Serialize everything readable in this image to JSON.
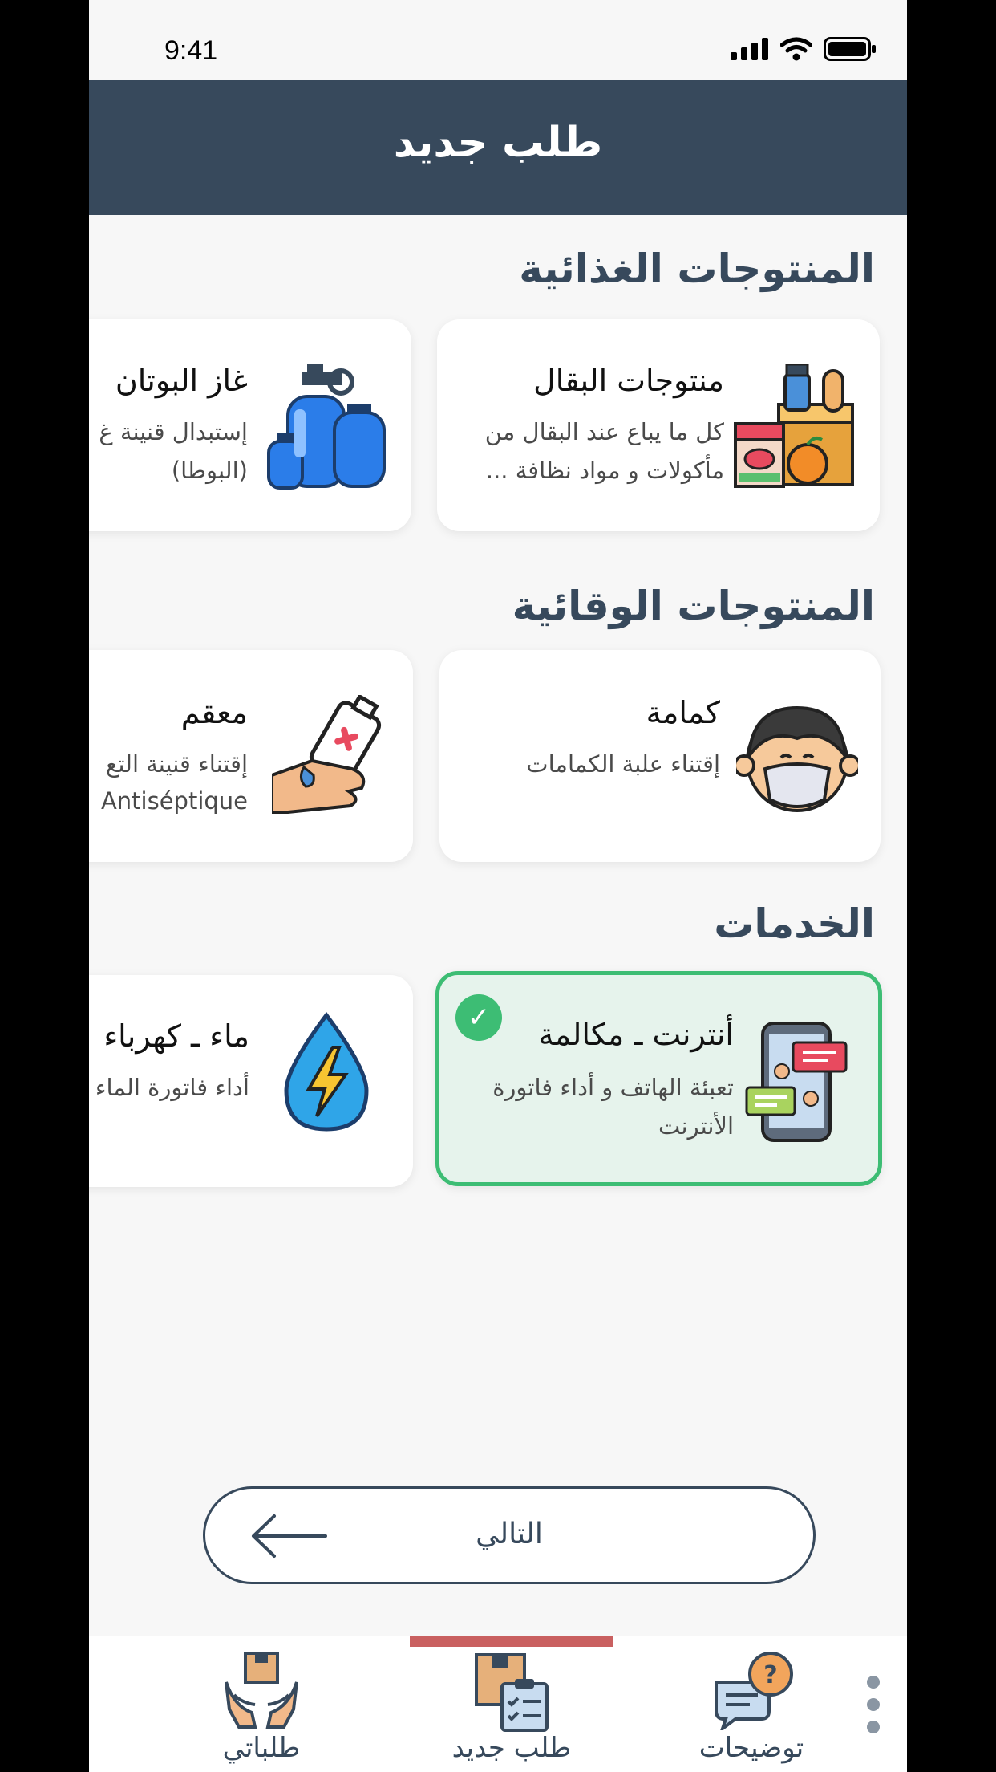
{
  "status_bar": {
    "time": "9:41"
  },
  "header": {
    "title": "طلب جديد"
  },
  "sections": [
    {
      "title": "المنتوجات الغذائية",
      "cards": [
        {
          "title": "منتوجات البقال",
          "desc_line1": "كل ما يباع عند البقال من",
          "desc_line2": "مأكولات و مواد نظافة ...",
          "icon": "grocery-icon"
        },
        {
          "title": "غاز البوتان",
          "desc_line1": "إستبدال قنينة غ",
          "desc_line2": "(البوطا)",
          "icon": "gas-cylinder-icon"
        }
      ]
    },
    {
      "title": "المنتوجات الوقائية",
      "cards": [
        {
          "title": "كمامة",
          "desc_line1": "إقتناء علبة الكمامات",
          "icon": "face-mask-icon"
        },
        {
          "title": "معقم",
          "desc_line1": "إقتناء قنينة التع",
          "desc_line2": "Antiséptique",
          "icon": "sanitizer-icon"
        }
      ]
    },
    {
      "title": "الخدمات",
      "cards": [
        {
          "title": "أنترنت ـ مكالمة",
          "desc_line1": "تعبئة الهاتف و أداء فاتورة",
          "desc_line2": "الأنترنت",
          "icon": "phone-chat-icon",
          "selected": true,
          "check": "✓"
        },
        {
          "title": "ماء ـ كهرباء",
          "desc_line1": "أداء فاتورة الماء",
          "icon": "water-electricity-icon"
        }
      ]
    }
  ],
  "next_button": {
    "label": "التالي"
  },
  "bottom_nav": {
    "items": [
      {
        "label": "طلباتي",
        "icon": "my-orders-icon"
      },
      {
        "label": "طلب جديد",
        "icon": "new-order-icon",
        "active": true
      },
      {
        "label": "توضيحات",
        "icon": "help-chat-icon"
      }
    ]
  },
  "colors": {
    "header": "#37495c",
    "accent_green": "#3dbd74",
    "indicator": "#c96060",
    "background": "#f7f7f7"
  }
}
